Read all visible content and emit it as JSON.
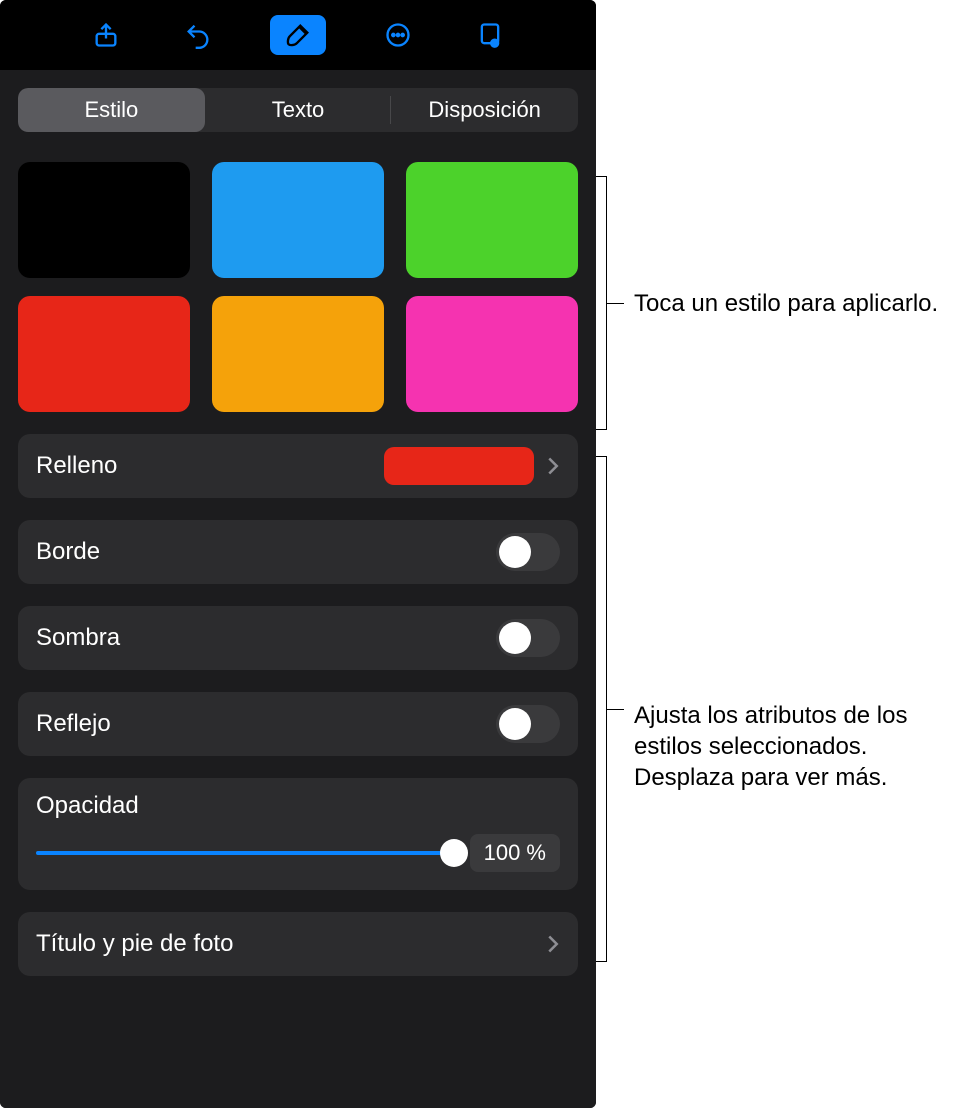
{
  "tabs": {
    "style": "Estilo",
    "text": "Texto",
    "layout": "Disposición"
  },
  "swatches": [
    "#000000",
    "#1e9bf0",
    "#4cd22b",
    "#e72618",
    "#f5a20a",
    "#f533b0"
  ],
  "rows": {
    "fill": {
      "label": "Relleno",
      "color": "#e72618"
    },
    "border": {
      "label": "Borde"
    },
    "shadow": {
      "label": "Sombra"
    },
    "reflection": {
      "label": "Reflejo"
    },
    "opacity": {
      "label": "Opacidad",
      "value": "100 %"
    },
    "caption": {
      "label": "Título y pie de foto"
    }
  },
  "callouts": {
    "styles": "Toca un estilo para aplicarlo.",
    "attributes": "Ajusta los atributos de los estilos seleccionados. Desplaza para ver más."
  }
}
